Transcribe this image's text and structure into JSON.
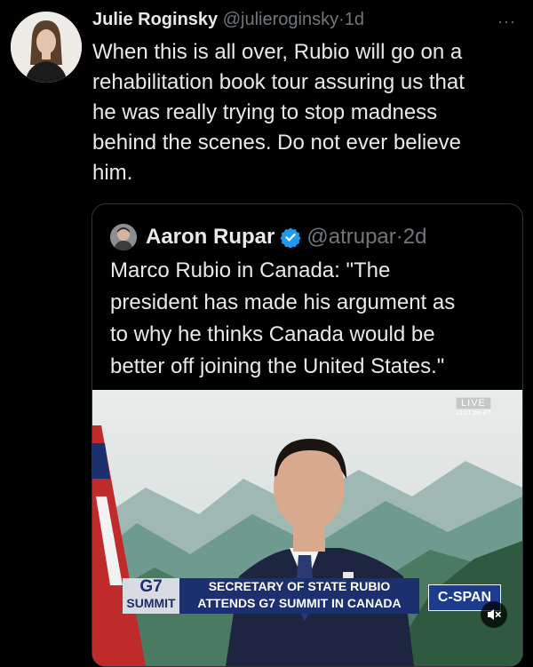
{
  "tweet": {
    "author_name": "Julie Roginsky",
    "handle": "@julieroginsky",
    "separator": "·",
    "time": "1d",
    "more": "···",
    "lines": [
      "When this is all over, Rubio will go on a",
      "rehabilitation book tour assuring us that",
      "he was really trying to stop madness",
      "behind the scenes. Do not ever believe",
      "him."
    ]
  },
  "quote": {
    "author_name": "Aaron Rupar",
    "handle": "@atrupar",
    "separator": "·",
    "time": "2d",
    "lines": [
      "Marco Rubio in Canada: \"The",
      "president has made his argument as",
      "to why he thinks Canada would be",
      "better off joining the United States.\""
    ]
  },
  "video": {
    "live_label": "LIVE",
    "live_time": "12:21 pm ET",
    "g7_top": "G7",
    "g7_bottom": "SUMMIT",
    "chyron_line1": "SECRETARY OF STATE RUBIO",
    "chyron_line2": "ATTENDS G7 SUMMIT IN CANADA",
    "network": "C-SPAN"
  },
  "colors": {
    "background": "#000000",
    "text": "#e7e9ea",
    "muted": "#71767b",
    "border": "#2f3336",
    "verified": "#1d9bf0"
  },
  "icons": {
    "verified": "verified-badge-icon",
    "more": "more-icon",
    "mute": "mute-icon"
  }
}
